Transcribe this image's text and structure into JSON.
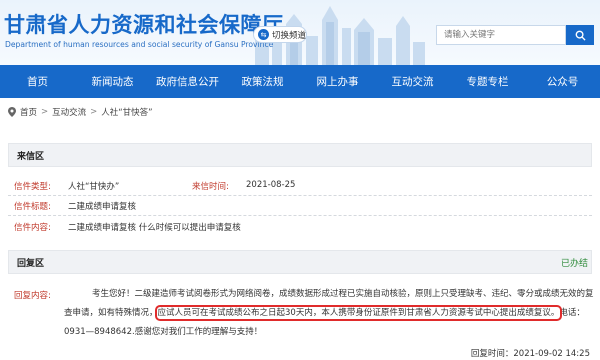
{
  "header": {
    "site_title": "甘肃省人力资源和社会保障厅",
    "site_subtitle": "Department of human resources and social security of Gansu Province",
    "switch_label": "切换频道",
    "search_placeholder": "请输入关键字"
  },
  "nav": {
    "items": [
      "首页",
      "新闻动态",
      "政府信息公开",
      "政策法规",
      "网上办事",
      "互动交流",
      "专题专栏",
      "公众号"
    ]
  },
  "breadcrumb": {
    "items": [
      "首页",
      "互动交流",
      "人社“甘快答”"
    ],
    "separator": ">"
  },
  "letter": {
    "section_title": "来信区",
    "type_label": "信件类型:",
    "type_value": "人社“甘快办”",
    "time_label": "来信时间:",
    "time_value": "2021-08-25",
    "subject_label": "信件标题:",
    "subject_value": "二建成绩申请复核",
    "content_label": "信件内容:",
    "content_value": "二建成绩申请复核 什么时候可以提出申请复核"
  },
  "reply": {
    "section_title": "回复区",
    "status": "已办结",
    "content_label": "回复内容:",
    "text_part1": "考生您好！二级建造师考试阅卷形式为网络阅卷，成绩数据形成过程已实施自动核验，原则上只受理缺考、违纪、零分或成绩无效的复查申请，如有特殊情况，",
    "text_highlight": "应试人员可在考试成绩公布之日起30天内，本人携带身份证原件到甘肃省人力资源考试中心提出成绩复议。",
    "text_part2": "电话：0931—8948642.感谢您对我们工作的理解与支持！",
    "time_label": "回复时间：",
    "time_value": "2021-09-02 14:25"
  },
  "colors": {
    "brand_blue": "#1769c9",
    "label_red": "#c0392b",
    "status_green": "#2e8b3a",
    "highlight_red": "#e02b2b"
  }
}
